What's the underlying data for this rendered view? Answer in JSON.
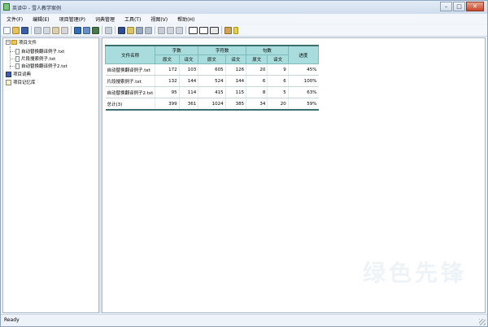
{
  "window": {
    "title": "英译中 - 雪人教学案例"
  },
  "menu": [
    "文件(F)",
    "编辑(E)",
    "项目管理(P)",
    "词典管理",
    "工具(T)",
    "视图(V)",
    "帮助(H)"
  ],
  "tree": {
    "root": "项目文件",
    "files": [
      "自动替换翻译例子.txt",
      "片段搜索例子.txt",
      "自动替换翻译例子2.txt"
    ],
    "dictionary": "项目词典",
    "memory": "项目记忆库"
  },
  "table": {
    "headers": {
      "file_name": "文件名称",
      "words": "字数",
      "chars": "字符数",
      "sentences": "句数",
      "progress": "进度",
      "source": "原文",
      "target": "译文"
    },
    "rows": [
      {
        "name": "自动替换翻译例子.txt",
        "words_src": "172",
        "words_tgt": "103",
        "chars_src": "605",
        "chars_tgt": "126",
        "sent_src": "20",
        "sent_tgt": "9",
        "progress": "45%"
      },
      {
        "name": "片段搜索例子.txt",
        "words_src": "132",
        "words_tgt": "144",
        "chars_src": "524",
        "chars_tgt": "144",
        "sent_src": "6",
        "sent_tgt": "6",
        "progress": "100%"
      },
      {
        "name": "自动替换翻译例子2.txt",
        "words_src": "95",
        "words_tgt": "114",
        "chars_src": "415",
        "chars_tgt": "115",
        "sent_src": "8",
        "sent_tgt": "5",
        "progress": "63%"
      }
    ],
    "total": {
      "name": "总计(3)",
      "words_src": "399",
      "words_tgt": "361",
      "chars_src": "1024",
      "chars_tgt": "385",
      "sent_src": "34",
      "sent_tgt": "20",
      "progress": "59%"
    }
  },
  "watermark": "绿色先锋",
  "status": "Ready",
  "colors": {
    "table_header": "#a9dcdc",
    "table_rule": "#3c6f6f",
    "title_bar": "#cfdcec"
  },
  "toolbar_icons": [
    "new-icon",
    "open-icon",
    "save-icon",
    "cut-icon",
    "copy-icon",
    "paste-icon",
    "delete-icon",
    "project-icon",
    "import-icon",
    "export-icon",
    "stats-icon",
    "dictionary-icon",
    "memory-icon",
    "search-icon",
    "replace-icon",
    "translate-icon",
    "prev-icon",
    "next-icon",
    "view-mode-1-icon",
    "view-mode-2-icon",
    "view-mode-3-icon",
    "home-icon",
    "help-icon"
  ]
}
